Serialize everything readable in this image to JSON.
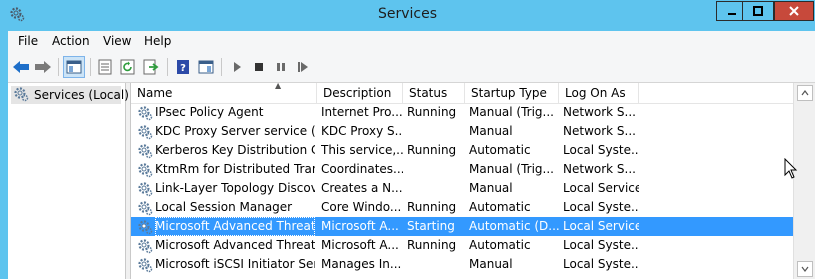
{
  "window": {
    "title": "Services"
  },
  "menu": {
    "items": [
      "File",
      "Action",
      "View",
      "Help"
    ]
  },
  "toolbar": {
    "buttons": [
      "back-icon",
      "forward-icon",
      "show-hide-console-tree-icon",
      "properties-icon",
      "refresh-icon",
      "export-list-icon",
      "help-icon",
      "show-hide-action-pane-icon",
      "start-service-icon",
      "stop-service-icon",
      "pause-service-icon",
      "restart-service-icon"
    ]
  },
  "tree": {
    "root_label": "Services (Local)"
  },
  "table": {
    "columns": [
      "Name",
      "Description",
      "Status",
      "Startup Type",
      "Log On As"
    ],
    "rows": [
      {
        "name": "IPsec Policy Agent",
        "description": "Internet Pro...",
        "status": "Running",
        "startup": "Manual (Trig...",
        "logon": "Network S..."
      },
      {
        "name": "KDC Proxy Server service (K...",
        "description": "KDC Proxy S...",
        "status": "",
        "startup": "Manual",
        "logon": "Network S..."
      },
      {
        "name": "Kerberos Key Distribution C...",
        "description": "This service,...",
        "status": "Running",
        "startup": "Automatic",
        "logon": "Local Syste..."
      },
      {
        "name": "KtmRm for Distributed Tran...",
        "description": "Coordinates...",
        "status": "",
        "startup": "Manual (Trig...",
        "logon": "Network S..."
      },
      {
        "name": "Link-Layer Topology Discov...",
        "description": "Creates a N...",
        "status": "",
        "startup": "Manual",
        "logon": "Local Service"
      },
      {
        "name": "Local Session Manager",
        "description": "Core Windo...",
        "status": "Running",
        "startup": "Automatic",
        "logon": "Local Syste..."
      },
      {
        "name": "Microsoft Advanced Threat ...",
        "description": "Microsoft A...",
        "status": "Starting",
        "startup": "Automatic (D...",
        "logon": "Local Service"
      },
      {
        "name": "Microsoft Advanced Threat ...",
        "description": "Microsoft A...",
        "status": "Running",
        "startup": "Automatic",
        "logon": "Local Syste..."
      },
      {
        "name": "Microsoft iSCSI Initiator Ser...",
        "description": "Manages In...",
        "status": "",
        "startup": "Manual",
        "logon": "Local Syste..."
      }
    ],
    "selected_index": 6
  },
  "colors": {
    "titlebar": "#5ec4ee",
    "close_button": "#c7493b",
    "selection": "#3399ff"
  }
}
